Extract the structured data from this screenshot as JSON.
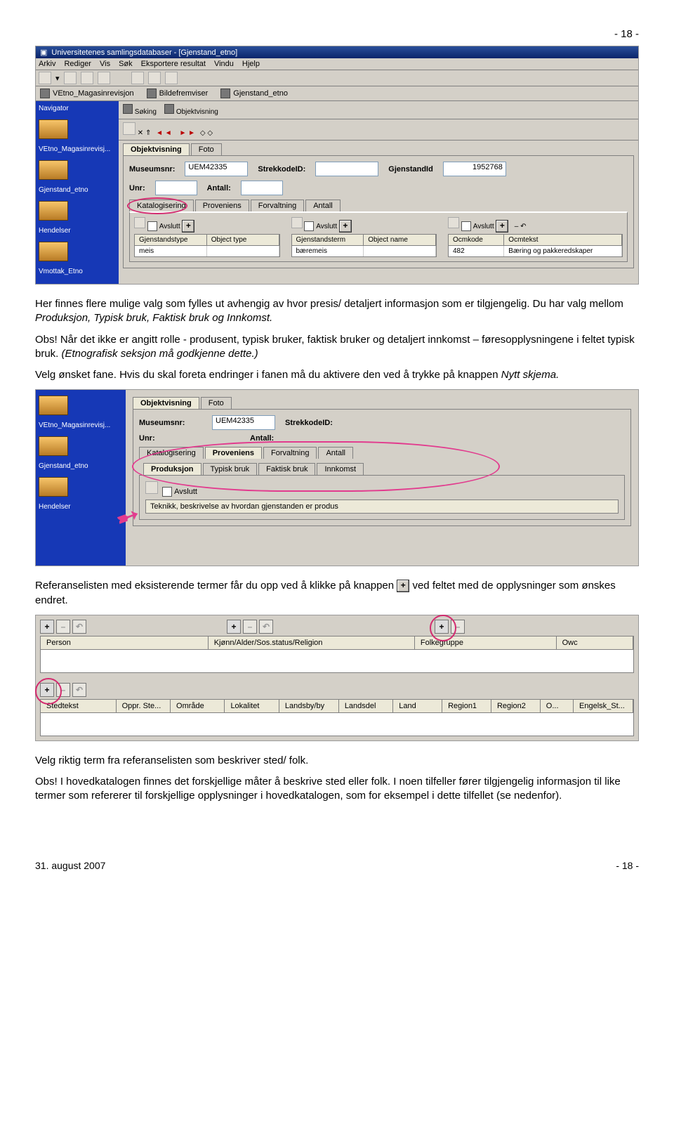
{
  "page_number_top": "- 18 -",
  "ss1": {
    "title": "Universitetenes samlingsdatabaser - [Gjenstand_etno]",
    "menu": [
      "Arkiv",
      "Rediger",
      "Vis",
      "Søk",
      "Eksportere resultat",
      "Vindu",
      "Hjelp"
    ],
    "childbar": [
      "VEtno_Magasinrevisjon",
      "Bildefremviser",
      "Gjenstand_etno"
    ],
    "sidebar": [
      "Navigator",
      "VEtno_Magasinrevisj...",
      "Gjenstand_etno",
      "Hendelser",
      "Vmottak_Etno"
    ],
    "side_tabs": [
      "Søking",
      "Objektvisning"
    ],
    "nav_arrows": "← ← → →",
    "obj_tabs": [
      "Objektvisning",
      "Foto"
    ],
    "fields": {
      "museumsnr_lbl": "Museumsnr:",
      "museumsnr_val": "UEM42335",
      "strekkode_lbl": "StrekkodeID:",
      "gjenstandid_lbl": "GjenstandId",
      "gjenstandid_val": "1952768",
      "unr_lbl": "Unr:",
      "antall_lbl": "Antall:"
    },
    "subtabs": [
      "Katalogisering",
      "Proveniens",
      "Forvaltning",
      "Antall"
    ],
    "avslutt": "Avslutt",
    "grid1": {
      "headers": [
        "Gjenstandstype",
        "Object type"
      ],
      "row": [
        "meis",
        ""
      ]
    },
    "grid2": {
      "headers": [
        "Gjenstandsterm",
        "Object name"
      ],
      "row": [
        "bæremeis",
        ""
      ]
    },
    "grid3": {
      "headers": [
        "Ocmkode",
        "Ocmtekst"
      ],
      "row": [
        "482",
        "Bæring og pakkeredskaper"
      ]
    }
  },
  "para1": {
    "a": "Her finnes flere mulige valg som fylles ut avhengig av hvor presis/ detaljert informasjon som er tilgjengelig. Du har valg mellom ",
    "i": "Produksjon, Typisk bruk, Faktisk bruk og Innkomst.",
    "obs": "Obs! Når det ikke er angitt rolle - produsent, typisk bruker, faktisk bruker og detaljert innkomst – føresopplysningene i feltet typisk bruk. ",
    "etn": "(Etnografisk seksjon må godkjenne dette.)",
    "c": "Velg ønsket fane. Hvis du skal foreta endringer i fanen må du aktivere den ved å trykke på knappen ",
    "ns": "Nytt skjema."
  },
  "ss2": {
    "sidebar": [
      "VEtno_Magasinrevisj...",
      "Gjenstand_etno",
      "Hendelser"
    ],
    "obj_tabs": [
      "Objektvisning",
      "Foto"
    ],
    "fields": {
      "museumsnr_lbl": "Museumsnr:",
      "museumsnr_val": "UEM42335",
      "strekkode_lbl": "StrekkodeID:",
      "unr_lbl": "Unr:",
      "antall_lbl": "Antall:"
    },
    "subtabs": [
      "Katalogisering",
      "Proveniens",
      "Forvaltning",
      "Antall"
    ],
    "subsub": [
      "Produksjon",
      "Typisk bruk",
      "Faktisk bruk",
      "Innkomst"
    ],
    "avslutt": "Avslutt",
    "desc": "Teknikk, beskrivelse av hvordan gjenstanden er produs"
  },
  "para2": {
    "a": "Referanselisten med eksisterende termer får du opp ved å klikke på knappen ",
    "b": " ved feltet med de opplysninger som ønskes endret."
  },
  "ss3": {
    "plus": "+",
    "top_headers": [
      "Person",
      "Kjønn/Alder/Sos.status/Religion",
      "Folkegruppe",
      "Owc"
    ],
    "bottom_headers": [
      "Stedtekst",
      "Oppr. Ste...",
      "Område",
      "Lokalitet",
      "Landsby/by",
      "Landsdel",
      "Land",
      "Region1",
      "Region2",
      "O...",
      "Engelsk_St..."
    ]
  },
  "para3": {
    "a": "Velg riktig term fra referanselisten som beskriver sted/ folk.",
    "b": "Obs! I hovedkatalogen finnes det forskjellige måter å beskrive sted eller folk. I noen tilfeller fører tilgjengelig informasjon til like termer som refererer til forskjellige opplysninger i hovedkatalogen, som for eksempel i dette tilfellet (se nedenfor)."
  },
  "footer": {
    "date": "31. august 2007",
    "page": "- 18 -"
  }
}
